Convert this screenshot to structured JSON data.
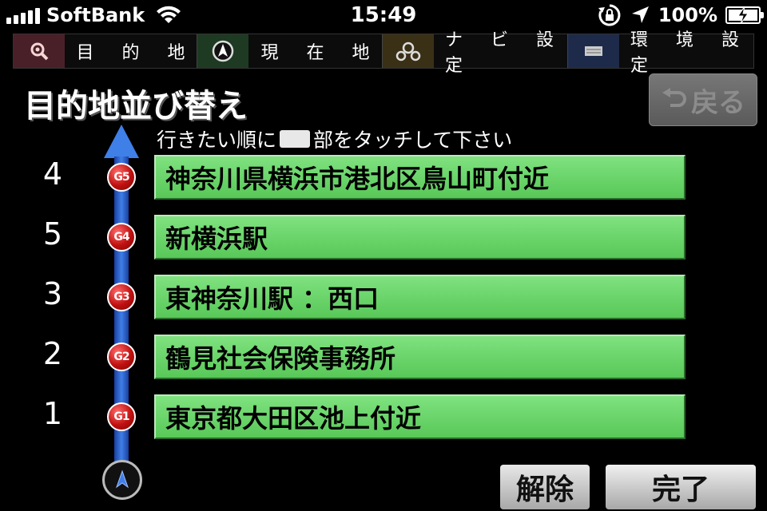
{
  "status_bar": {
    "carrier": "SoftBank",
    "time": "15:49",
    "battery_percent": "100%",
    "battery_level": 1.0
  },
  "tabs": [
    {
      "label": "目 的 地",
      "icon": "search-icon"
    },
    {
      "label": "現 在 地",
      "icon": "compass-arrow-icon"
    },
    {
      "label": "ナ ビ 設 定",
      "icon": "car-gear-icon"
    },
    {
      "label": "環 境 設 定",
      "icon": "settings-panel-icon"
    }
  ],
  "page": {
    "title": "目的地並び替え",
    "back_label": "戻る",
    "instruction_before": "行きたい順に",
    "instruction_after": "部をタッチして下さい"
  },
  "destinations": [
    {
      "order": "4",
      "badge": "G5",
      "name": "神奈川県横浜市港北区鳥山町付近"
    },
    {
      "order": "5",
      "badge": "G4",
      "name": "新横浜駅"
    },
    {
      "order": "3",
      "badge": "G3",
      "name": "東神奈川駅 ：西口"
    },
    {
      "order": "2",
      "badge": "G2",
      "name": "鶴見社会保険事務所"
    },
    {
      "order": "1",
      "badge": "G1",
      "name": "東京都大田区池上付近"
    }
  ],
  "buttons": {
    "cancel_label": "解除",
    "done_label": "完了"
  },
  "colors": {
    "destination_bg": "#6cd86c",
    "route_line": "#3f7fe8",
    "badge": "#c01010"
  }
}
